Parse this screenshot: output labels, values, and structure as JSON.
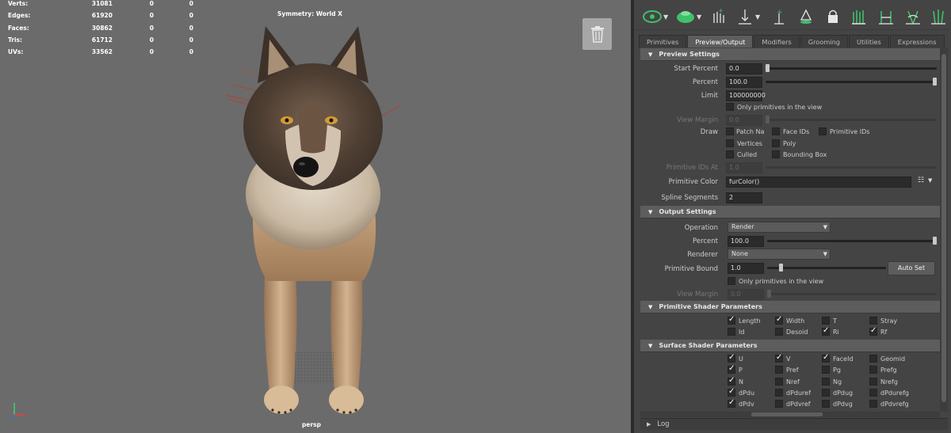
{
  "viewport": {
    "hud": [
      {
        "label": "Verts:",
        "v1": "31081",
        "v2": "0",
        "v3": "0"
      },
      {
        "label": "Edges:",
        "v1": "61920",
        "v2": "0",
        "v3": "0"
      },
      {
        "label": "Faces:",
        "v1": "30862",
        "v2": "0",
        "v3": "0"
      },
      {
        "label": "Tris:",
        "v1": "61712",
        "v2": "0",
        "v3": "0"
      },
      {
        "label": "UVs:",
        "v1": "33562",
        "v2": "0",
        "v3": "0"
      }
    ],
    "symmetry_label": "Symmetry: World X",
    "camera_label": "persp",
    "trash_icon": "trash-icon"
  },
  "toolbar": {
    "icons": [
      "eye-visibility-icon",
      "sphere-display-icon",
      "add-feathers-icon",
      "comb-down-icon",
      "add-primitive-icon",
      "paint-icon",
      "lock-icon",
      "grass-icon",
      "cut-icon",
      "puff-icon",
      "grass-grow-icon"
    ]
  },
  "tabs": [
    "Primitives",
    "Preview/Output",
    "Modifiers",
    "Grooming",
    "Utilities",
    "Expressions"
  ],
  "active_tab": "Preview/Output",
  "preview": {
    "header": "Preview Settings",
    "start_percent_label": "Start Percent",
    "start_percent_value": "0.0",
    "start_percent_level": 0.0,
    "percent_label": "Percent",
    "percent_value": "100.0",
    "percent_level": 1.0,
    "limit_label": "Limit",
    "limit_value": "100000000",
    "only_prims_label": "Only primitives in the view",
    "view_margin_label": "View Margin",
    "view_margin_value": "0.0",
    "draw_label": "Draw",
    "draw_options": {
      "patch_na": "Patch Na",
      "face_ids": "Face IDs",
      "primitive_ids": "Primitive IDs",
      "vertices": "Vertices",
      "poly": "Poly",
      "culled": "Culled",
      "bounding_box": "Bounding Box"
    },
    "primitive_ids_at_label": "Primitive IDs At",
    "primitive_ids_at_value": "1.0",
    "primitive_color_label": "Primitive Color",
    "primitive_color_value": "furColor()",
    "spline_segments_label": "Spline Segments",
    "spline_segments_value": "2"
  },
  "output": {
    "header": "Output Settings",
    "operation_label": "Operation",
    "operation_value": "Render",
    "percent_label": "Percent",
    "percent_value": "100.0",
    "percent_level": 1.0,
    "renderer_label": "Renderer",
    "renderer_value": "None",
    "primitive_bound_label": "Primitive Bound",
    "primitive_bound_value": "1.0",
    "primitive_bound_level": 0.1,
    "auto_set_label": "Auto Set",
    "only_prims_label": "Only primitives in the view",
    "view_margin_label": "View Margin",
    "view_margin_value": "0.0"
  },
  "prim_shader": {
    "header": "Primitive Shader Parameters",
    "items": [
      {
        "label": "Length",
        "checked": true
      },
      {
        "label": "Width",
        "checked": true
      },
      {
        "label": "T",
        "checked": false
      },
      {
        "label": "Stray",
        "checked": false
      },
      {
        "label": "Id",
        "checked": false
      },
      {
        "label": "Desoid",
        "checked": false
      },
      {
        "label": "Ri",
        "checked": true
      },
      {
        "label": "Rf",
        "checked": true
      }
    ]
  },
  "surf_shader": {
    "header": "Surface Shader Parameters",
    "items": [
      {
        "label": "U",
        "checked": true
      },
      {
        "label": "V",
        "checked": true
      },
      {
        "label": "FaceId",
        "checked": true
      },
      {
        "label": "Geomid",
        "checked": false
      },
      {
        "label": "P",
        "checked": true
      },
      {
        "label": "Pref",
        "checked": false
      },
      {
        "label": "Pg",
        "checked": false
      },
      {
        "label": "Prefg",
        "checked": false
      },
      {
        "label": "N",
        "checked": true
      },
      {
        "label": "Nref",
        "checked": false
      },
      {
        "label": "Ng",
        "checked": false
      },
      {
        "label": "Nrefg",
        "checked": false
      },
      {
        "label": "dPdu",
        "checked": true
      },
      {
        "label": "dPduref",
        "checked": false
      },
      {
        "label": "dPdug",
        "checked": false
      },
      {
        "label": "dPdurefg",
        "checked": false
      },
      {
        "label": "dPdv",
        "checked": true
      },
      {
        "label": "dPdvref",
        "checked": false
      },
      {
        "label": "dPdvg",
        "checked": false
      },
      {
        "label": "dPdvrefg",
        "checked": false
      }
    ]
  },
  "log_label": "Log"
}
